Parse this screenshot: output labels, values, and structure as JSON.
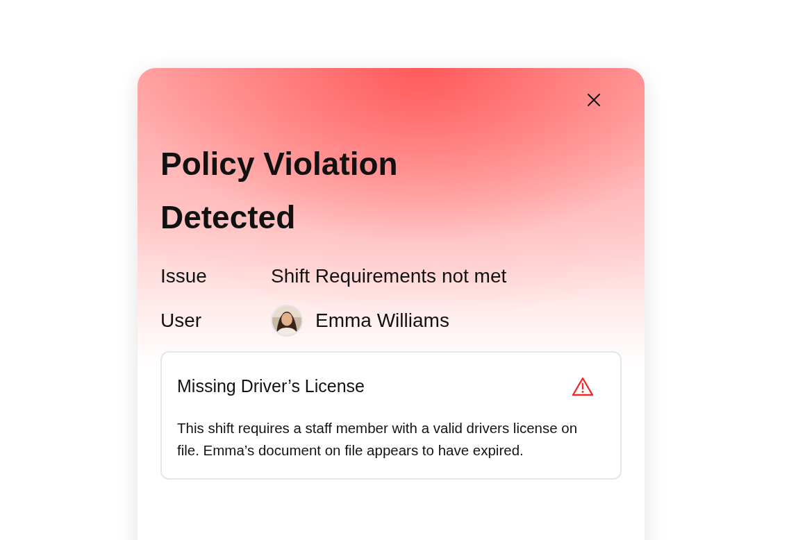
{
  "dialog": {
    "title": "Policy Violation Detected",
    "fields": [
      {
        "kind": "text",
        "label": "Issue",
        "value": "Shift Requirements not met"
      },
      {
        "kind": "user",
        "label": "User",
        "value": "Emma Williams"
      }
    ],
    "alert": {
      "title": "Missing Driver’s License",
      "body": "This shift requires a staff member with a valid drivers license on file. Emma’s document on file appears to have expired."
    }
  }
}
